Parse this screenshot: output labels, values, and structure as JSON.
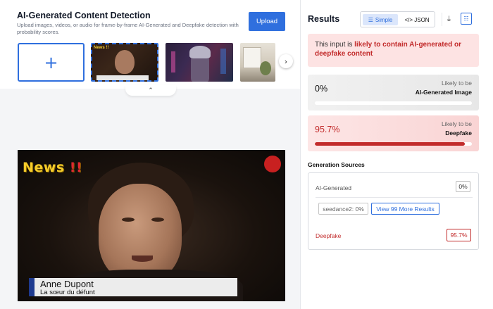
{
  "upload": {
    "title": "AI-Generated Content Detection",
    "subtitle": "Upload images, videos, or audio for frame-by-frame AI-Generated and Deepfake detection with probability scores.",
    "upload_label": "Upload",
    "add_glyph": "+",
    "thumbnails": [
      "news-video-frame",
      "neon-portrait",
      "interior-room"
    ],
    "thumb_news_text": "News !!"
  },
  "video": {
    "news_text": "News",
    "news_excl": "!!",
    "name": "Anne Dupont",
    "caption": "La sœur du défunt"
  },
  "results": {
    "title": "Results",
    "toggle_simple": "Simple",
    "toggle_json": "</> JSON",
    "alert_prefix": "This input is ",
    "alert_highlight": "likely to contain AI-generated or deepfake content",
    "ai_card": {
      "percent": "0%",
      "likely": "Likely to be",
      "label": "AI-Generated Image",
      "fill": 0
    },
    "df_card": {
      "percent": "95.7%",
      "likely": "Likely to be",
      "label": "Deepfake",
      "fill": 0.957
    },
    "generation_sources_title": "Generation Sources",
    "gen_ai_label": "AI-Generated",
    "gen_ai_pct": "0%",
    "seed_label": "seedance2: 0%",
    "more_results": "View 99 More Results",
    "deepfake_label": "Deepfake",
    "deepfake_pct": "95.7%"
  },
  "colors": {
    "accent": "#2f6fde",
    "danger": "#c22b2b",
    "alert_bg": "#fde3e3"
  }
}
